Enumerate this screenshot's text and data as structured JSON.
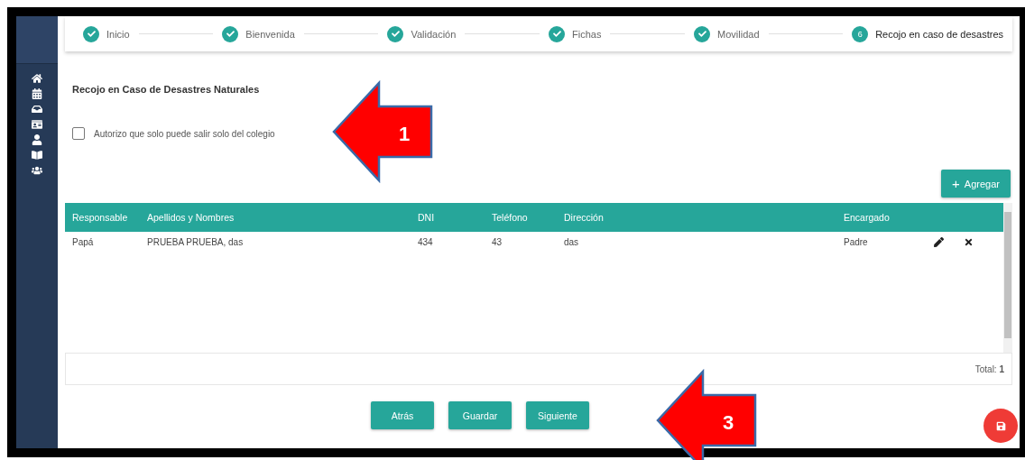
{
  "steps": [
    {
      "label": "Inicio",
      "done": true,
      "selected": false
    },
    {
      "label": "Bienvenida",
      "done": true,
      "selected": false
    },
    {
      "label": "Validación",
      "done": true,
      "selected": false
    },
    {
      "label": "Fichas",
      "done": true,
      "selected": false
    },
    {
      "label": "Movilidad",
      "done": true,
      "selected": false
    },
    {
      "label": "Recojo en caso de desastres",
      "done": false,
      "selected": true,
      "number": "6"
    }
  ],
  "section_title": "Recojo en Caso de Desastres Naturales",
  "authorization": {
    "label": "Autorizo que solo puede salir solo del colegio",
    "checked": false
  },
  "add_button": {
    "icon": "+",
    "label": "Agregar"
  },
  "table": {
    "columns": [
      "Responsable",
      "Apellidos y Nombres",
      "DNI",
      "Teléfono",
      "Dirección",
      "Encargado"
    ],
    "rows": [
      {
        "cells": [
          "Papá",
          "PRUEBA PRUEBA, das",
          "434",
          "43",
          "das",
          "Padre"
        ]
      }
    ],
    "footer": "Total: **1**"
  },
  "buttons": [
    "Atrás",
    "Guardar",
    "Siguiente"
  ],
  "annotations": [
    {
      "number": "1"
    },
    {
      "number": "3"
    }
  ]
}
